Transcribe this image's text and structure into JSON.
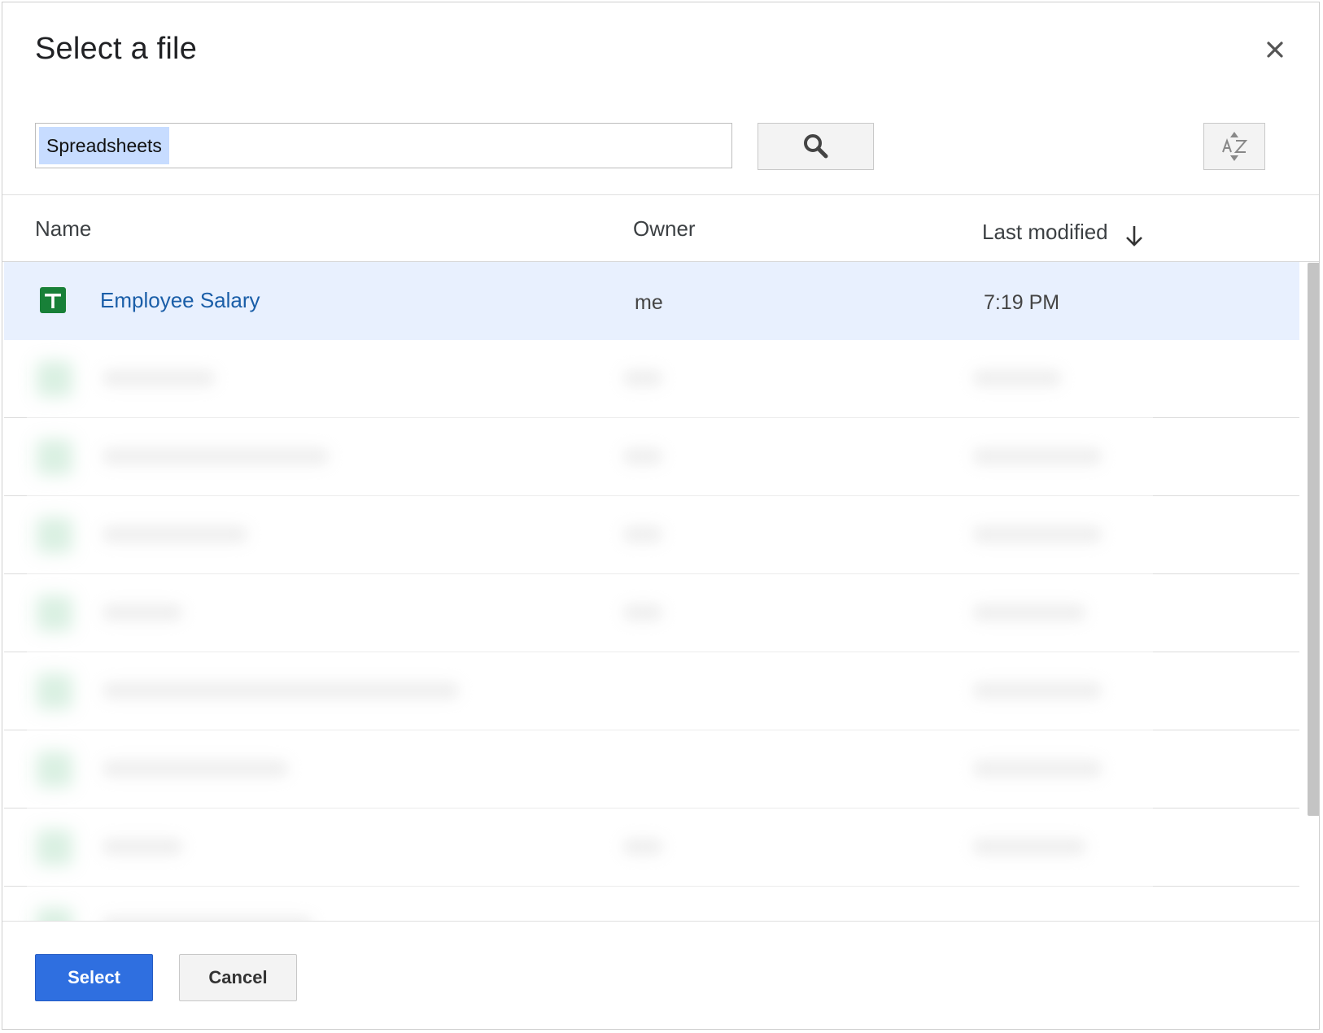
{
  "dialog": {
    "title": "Select a file"
  },
  "search": {
    "value": "Spreadsheets"
  },
  "columns": {
    "name": "Name",
    "owner": "Owner",
    "last_modified": "Last modified"
  },
  "files": [
    {
      "name": "Employee Salary",
      "owner": "me",
      "modified": "7:19 PM",
      "selected": true,
      "icon": "google-sheets-icon"
    }
  ],
  "footer": {
    "select_label": "Select",
    "cancel_label": "Cancel"
  },
  "colors": {
    "accent": "#2f6fe0",
    "selected_row": "#e8f0fe",
    "sheets_green": "#188038",
    "search_chip": "#c7dcff"
  }
}
